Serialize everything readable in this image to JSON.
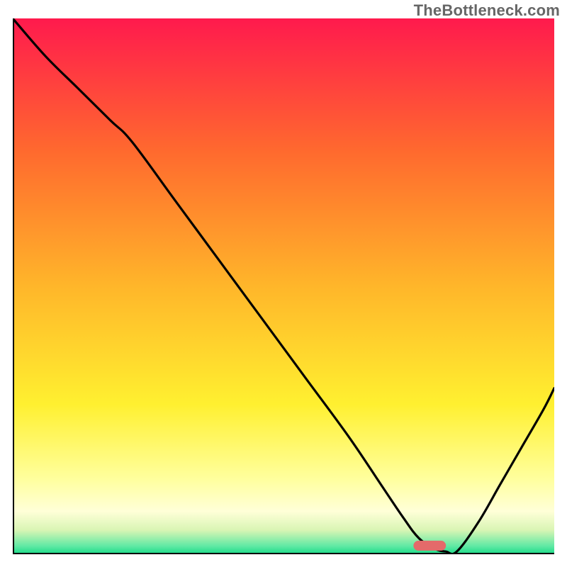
{
  "watermark": "TheBottleneck.com",
  "chart_data": {
    "type": "line",
    "title": "",
    "xlabel": "",
    "ylabel": "",
    "xlim": [
      0,
      100
    ],
    "ylim": [
      0,
      100
    ],
    "grid": false,
    "watermark": "TheBottleneck.com",
    "background": {
      "type": "vertical-gradient",
      "stops": [
        {
          "pos": 0.0,
          "color": "#ff1a4d"
        },
        {
          "pos": 0.25,
          "color": "#ff6a2e"
        },
        {
          "pos": 0.5,
          "color": "#ffb62a"
        },
        {
          "pos": 0.72,
          "color": "#fff030"
        },
        {
          "pos": 0.86,
          "color": "#ffff9e"
        },
        {
          "pos": 0.92,
          "color": "#ffffd8"
        },
        {
          "pos": 0.955,
          "color": "#d9f5b4"
        },
        {
          "pos": 0.985,
          "color": "#5fe9a4"
        },
        {
          "pos": 1.0,
          "color": "#19db87"
        }
      ]
    },
    "series": [
      {
        "name": "bottleneck-curve",
        "color": "#000000",
        "x": [
          0,
          6,
          12,
          18,
          22,
          30,
          38,
          46,
          54,
          62,
          68,
          72,
          75,
          78,
          80,
          82,
          86,
          90,
          94,
          98,
          100
        ],
        "values": [
          100,
          93,
          87,
          81,
          77,
          66,
          55,
          44,
          33,
          22,
          13,
          7,
          3,
          1,
          0.5,
          0.5,
          6,
          13,
          20,
          27,
          31
        ]
      }
    ],
    "marker": {
      "name": "optimal-range",
      "shape": "capsule",
      "color": "#e46a6a",
      "x_range": [
        74,
        80
      ],
      "y": 1.6
    },
    "axes": {
      "x_visible": true,
      "y_visible": true,
      "axis_color": "#000000",
      "axis_width": 4
    }
  }
}
